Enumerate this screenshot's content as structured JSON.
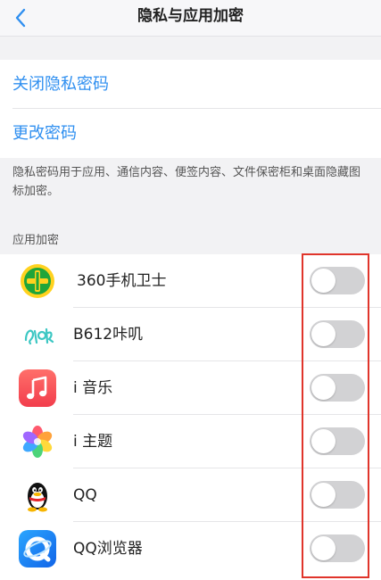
{
  "header": {
    "title": "隐私与应用加密",
    "back_icon": "chevron-left-icon"
  },
  "privacy": {
    "close_password": "关闭隐私密码",
    "change_password": "更改密码",
    "description": "隐私密码用于应用、通信内容、便签内容、文件保密柜和桌面隐藏图标加密。"
  },
  "app_lock": {
    "section_title": "应用加密",
    "apps": [
      {
        "name": "360手机卫士",
        "icon": "360-security-icon",
        "enabled": false
      },
      {
        "name": "B612咔叽",
        "icon": "b612-icon",
        "enabled": false
      },
      {
        "name": "i 音乐",
        "icon": "music-note-icon",
        "enabled": false
      },
      {
        "name": "i 主题",
        "icon": "theme-flower-icon",
        "enabled": false
      },
      {
        "name": "QQ",
        "icon": "qq-penguin-icon",
        "enabled": false
      },
      {
        "name": "QQ浏览器",
        "icon": "qq-browser-icon",
        "enabled": false
      }
    ]
  },
  "colors": {
    "accent_blue": "#2f8ff0",
    "toggle_off": "#d2d2d4",
    "highlight_red": "#e0352b"
  }
}
